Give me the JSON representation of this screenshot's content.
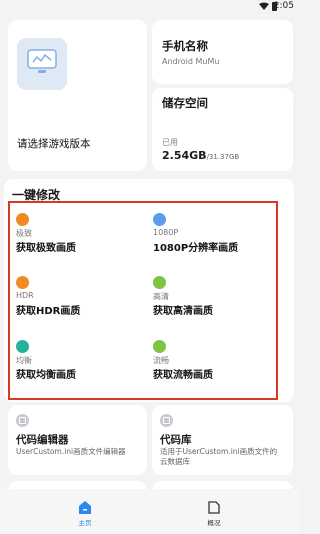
{
  "status_bar": {
    "time": "2:05"
  },
  "game_card": {
    "label": "请选择游戏版本"
  },
  "phone_card": {
    "title": "手机名称",
    "device": "Android MuMu"
  },
  "storage_card": {
    "title": "储存空间",
    "used_label": "已用",
    "used": "2.54GB",
    "total": "/31.37GB"
  },
  "mod_section": {
    "title": "一键修改",
    "options": [
      {
        "tag": "极致",
        "name": "获取极致画质",
        "color": "#f08a24"
      },
      {
        "tag": "1080P",
        "name": "1080P分辨率画质",
        "color": "#5b9cf0"
      },
      {
        "tag": "HDR",
        "name": "获取HDR画质",
        "color": "#f08a24"
      },
      {
        "tag": "高清",
        "name": "获取高清画质",
        "color": "#7cc443"
      },
      {
        "tag": "均衡",
        "name": "获取均衡画质",
        "color": "#23b39b"
      },
      {
        "tag": "流畅",
        "name": "获取流畅画质",
        "color": "#7cc443"
      }
    ]
  },
  "tools": [
    {
      "title": "代码编辑器",
      "desc": "UserCustom.ini画质文件编辑器"
    },
    {
      "title": "代码库",
      "desc": "适用于UserCustom.ini画质文件的云数据库"
    }
  ],
  "bottom_nav": {
    "home": "主页",
    "overview": "概况"
  },
  "colors": {
    "accent": "#2b86ee",
    "highlight_border": "#d93a1f"
  }
}
